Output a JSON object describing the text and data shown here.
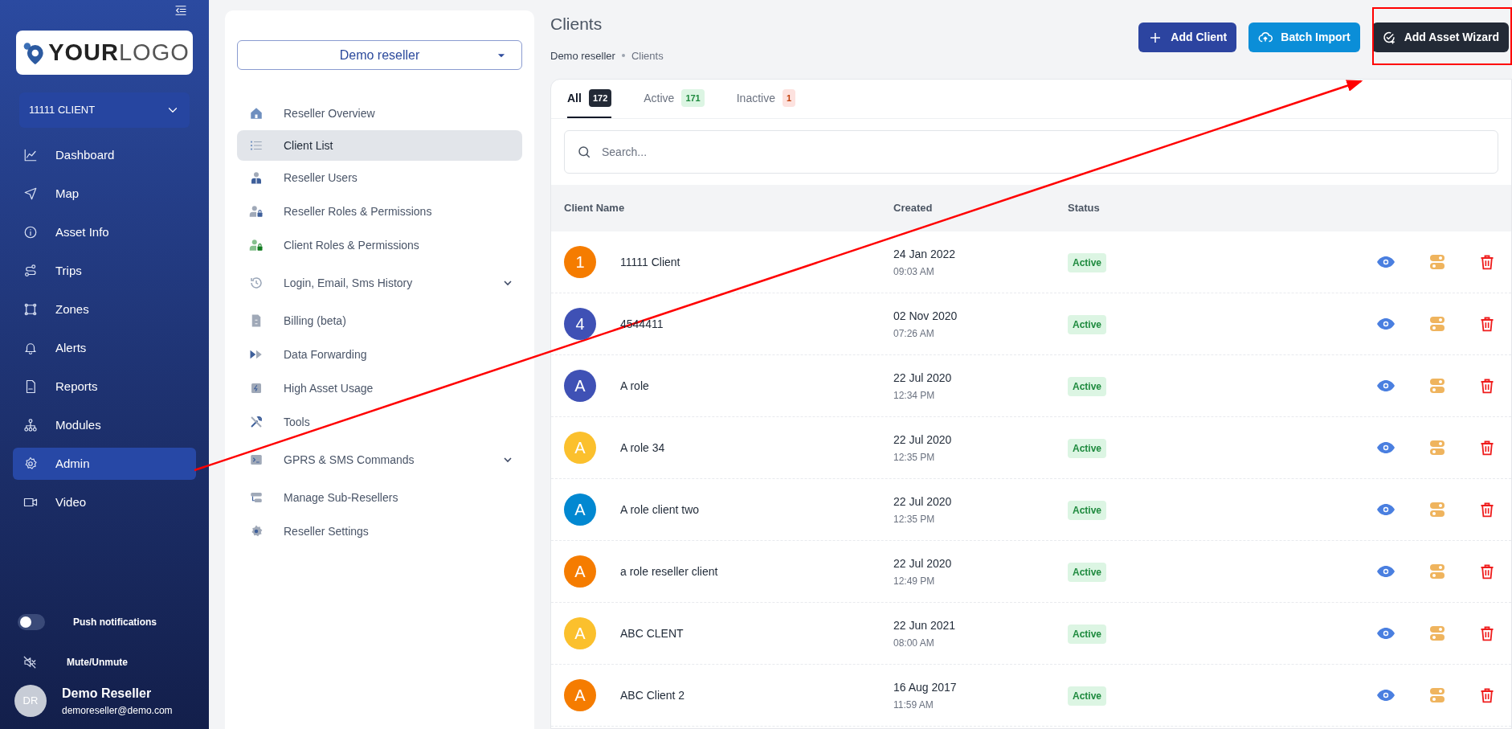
{
  "sidebar": {
    "logo_text": {
      "bold": "YOUR",
      "light": "LOGO"
    },
    "client_select": "11111 CLIENT",
    "nav": [
      {
        "label": "Dashboard",
        "selected": false
      },
      {
        "label": "Map",
        "selected": false
      },
      {
        "label": "Asset Info",
        "selected": false
      },
      {
        "label": "Trips",
        "selected": false
      },
      {
        "label": "Zones",
        "selected": false
      },
      {
        "label": "Alerts",
        "selected": false
      },
      {
        "label": "Reports",
        "selected": false
      },
      {
        "label": "Modules",
        "selected": false
      },
      {
        "label": "Admin",
        "selected": true
      },
      {
        "label": "Video",
        "selected": false
      }
    ],
    "push_notifications": {
      "label": "Push notifications",
      "on": false
    },
    "mute": {
      "label": "Mute/Unmute"
    },
    "user": {
      "initials": "DR",
      "name": "Demo Reseller",
      "email": "demoreseller@demo.com"
    }
  },
  "admin_menu": {
    "reseller_select": "Demo reseller",
    "items": [
      {
        "label": "Reseller Overview",
        "selected": false,
        "submenu": false
      },
      {
        "label": "Client List",
        "selected": true,
        "submenu": false
      },
      {
        "label": "Reseller Users",
        "selected": false,
        "submenu": false
      },
      {
        "label": "Reseller Roles & Permissions",
        "selected": false,
        "submenu": false
      },
      {
        "label": "Client Roles & Permissions",
        "selected": false,
        "submenu": false
      },
      {
        "label": "Login, Email, Sms History",
        "selected": false,
        "submenu": true
      },
      {
        "label": "Billing (beta)",
        "selected": false,
        "submenu": false
      },
      {
        "label": "Data Forwarding",
        "selected": false,
        "submenu": false
      },
      {
        "label": "High Asset Usage",
        "selected": false,
        "submenu": false
      },
      {
        "label": "Tools",
        "selected": false,
        "submenu": false
      },
      {
        "label": "GPRS & SMS Commands",
        "selected": false,
        "submenu": true
      },
      {
        "label": "Manage Sub-Resellers",
        "selected": false,
        "submenu": false
      },
      {
        "label": "Reseller Settings",
        "selected": false,
        "submenu": false
      }
    ]
  },
  "page": {
    "title": "Clients",
    "breadcrumb": [
      "Demo reseller",
      "Clients"
    ],
    "buttons": [
      {
        "label": "Add Client",
        "kind": "add"
      },
      {
        "label": "Batch Import",
        "kind": "import"
      },
      {
        "label": "Add Asset Wizard",
        "kind": "wizard"
      }
    ]
  },
  "tabs": [
    {
      "label": "All",
      "count": "172",
      "kind": "all",
      "selected": true
    },
    {
      "label": "Active",
      "count": "171",
      "kind": "active",
      "selected": false
    },
    {
      "label": "Inactive",
      "count": "1",
      "kind": "inactive",
      "selected": false
    }
  ],
  "search": {
    "placeholder": "Search..."
  },
  "table": {
    "columns": [
      "Client Name",
      "Created",
      "Status"
    ],
    "rows": [
      {
        "initial": "1",
        "color": "#f57c00",
        "name": "11111 Client",
        "date": "24 Jan 2022",
        "time": "09:03 AM",
        "status": "Active"
      },
      {
        "initial": "4",
        "color": "#3f51b5",
        "name": "4544411",
        "date": "02 Nov 2020",
        "time": "07:26 AM",
        "status": "Active"
      },
      {
        "initial": "A",
        "color": "#3f51b5",
        "name": "A role",
        "date": "22 Jul 2020",
        "time": "12:34 PM",
        "status": "Active"
      },
      {
        "initial": "A",
        "color": "#fbc02d",
        "name": "A role 34",
        "date": "22 Jul 2020",
        "time": "12:35 PM",
        "status": "Active"
      },
      {
        "initial": "A",
        "color": "#0288d1",
        "name": "A role client two",
        "date": "22 Jul 2020",
        "time": "12:35 PM",
        "status": "Active"
      },
      {
        "initial": "A",
        "color": "#f57c00",
        "name": "a role reseller client",
        "date": "22 Jul 2020",
        "time": "12:49 PM",
        "status": "Active"
      },
      {
        "initial": "A",
        "color": "#fbc02d",
        "name": "ABC CLENT",
        "date": "22 Jun 2021",
        "time": "08:00 AM",
        "status": "Active"
      },
      {
        "initial": "A",
        "color": "#f57c00",
        "name": "ABC Client 2",
        "date": "16 Aug 2017",
        "time": "11:59 AM",
        "status": "Active"
      }
    ]
  }
}
